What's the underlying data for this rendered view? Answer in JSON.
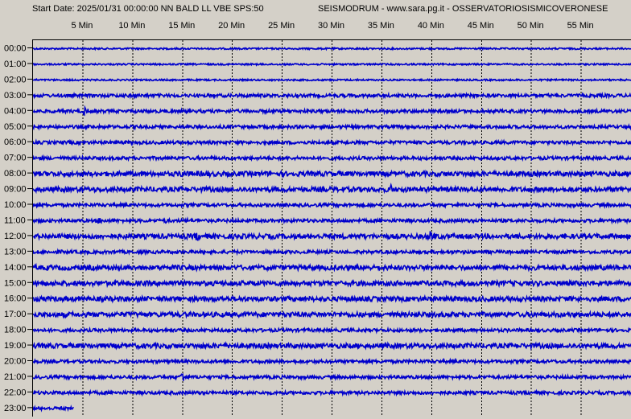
{
  "header": {
    "start_info": "Start Date: 2025/01/31 00:00:00 NN BALD LL VBE SPS:50",
    "station_info": "SEISMODRUM - www.sara.pg.it - OSSERVATORIOSISMICOVERONESE"
  },
  "colors": {
    "background": "#d4d0c8",
    "trace": "#0000cc",
    "grid": "#000000"
  },
  "chart_data": {
    "type": "line",
    "subtype": "seismic-helicorder",
    "title": "",
    "x_ticks": [
      "5 Min",
      "10 Min",
      "15 Min",
      "20 Min",
      "25 Min",
      "30 Min",
      "35 Min",
      "40 Min",
      "45 Min",
      "50 Min",
      "55 Min"
    ],
    "x_tick_values": [
      5,
      10,
      15,
      20,
      25,
      30,
      35,
      40,
      45,
      50,
      55
    ],
    "xlim": [
      0,
      60
    ],
    "rows": [
      "00:00",
      "01:00",
      "02:00",
      "03:00",
      "04:00",
      "05:00",
      "06:00",
      "07:00",
      "08:00",
      "09:00",
      "10:00",
      "11:00",
      "12:00",
      "13:00",
      "14:00",
      "15:00",
      "16:00",
      "17:00",
      "18:00",
      "19:00",
      "20:00",
      "21:00",
      "22:00",
      "23:00"
    ],
    "grid": "dashed vertical lines at each 5 minutes",
    "row_noise_level": [
      1,
      1,
      1,
      2,
      2,
      2,
      2,
      2,
      3,
      3,
      2,
      2,
      3,
      2,
      3,
      3,
      3,
      3,
      2,
      3,
      2,
      2,
      2,
      2
    ],
    "last_row_end_min": 4,
    "events": [
      {
        "row": "03:00",
        "minute": 57,
        "amplitude": 2
      },
      {
        "row": "04:00",
        "minute": 5.1,
        "amplitude": 6
      },
      {
        "row": "04:00",
        "minute": 15.3,
        "amplitude": 3
      },
      {
        "row": "08:00",
        "minute": 14.9,
        "amplitude": 8
      },
      {
        "row": "08:00",
        "minute": 17.5,
        "amplitude": 5
      },
      {
        "row": "08:00",
        "minute": 35.5,
        "amplitude": 4
      },
      {
        "row": "09:00",
        "minute": 35.8,
        "amplitude": 7
      },
      {
        "row": "11:00",
        "minute": 6.6,
        "amplitude": 5
      },
      {
        "row": "11:00",
        "minute": 13.2,
        "amplitude": 4
      },
      {
        "row": "11:00",
        "minute": 15.5,
        "amplitude": 3
      },
      {
        "row": "11:00",
        "minute": 47.4,
        "amplitude": 3
      },
      {
        "row": "12:00",
        "minute": 16.3,
        "amplitude": 8
      },
      {
        "row": "12:00",
        "minute": 39.9,
        "amplitude": 9
      },
      {
        "row": "12:00",
        "minute": 49.8,
        "amplitude": 3
      },
      {
        "row": "13:00",
        "minute": 2.8,
        "amplitude": 3
      },
      {
        "row": "14:00",
        "minute": 31.3,
        "amplitude": 3
      },
      {
        "row": "14:00",
        "minute": 38.1,
        "amplitude": 3
      },
      {
        "row": "14:00",
        "minute": 45.5,
        "amplitude": 3
      },
      {
        "row": "20:00",
        "minute": 47.8,
        "amplitude": 3
      },
      {
        "row": "21:00",
        "minute": 14.9,
        "amplitude": 8
      },
      {
        "row": "21:00",
        "minute": 33.8,
        "amplitude": 2
      }
    ]
  }
}
